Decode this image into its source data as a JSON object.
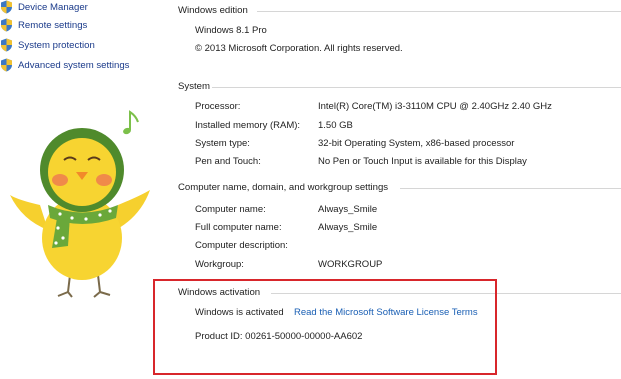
{
  "sidebar": {
    "items": [
      {
        "label": "Device Manager"
      },
      {
        "label": "Remote settings"
      },
      {
        "label": "System protection"
      },
      {
        "label": "Advanced system settings"
      }
    ]
  },
  "windows_edition": {
    "title": "Windows edition",
    "edition": "Windows 8.1 Pro",
    "copyright": "© 2013 Microsoft Corporation. All rights reserved."
  },
  "system": {
    "title": "System",
    "rows": [
      {
        "label": "Processor:",
        "value": "Intel(R) Core(TM) i3-3110M CPU @ 2.40GHz   2.40 GHz"
      },
      {
        "label": "Installed memory (RAM):",
        "value": "1.50 GB"
      },
      {
        "label": "System type:",
        "value": "32-bit Operating System, x86-based processor"
      },
      {
        "label": "Pen and Touch:",
        "value": "No Pen or Touch Input is available for this Display"
      }
    ]
  },
  "computer_name": {
    "title": "Computer name, domain, and workgroup settings",
    "rows": [
      {
        "label": "Computer name:",
        "value": "Always_Smile"
      },
      {
        "label": "Full computer name:",
        "value": "Always_Smile"
      },
      {
        "label": "Computer description:",
        "value": ""
      },
      {
        "label": "Workgroup:",
        "value": "WORKGROUP"
      }
    ]
  },
  "activation": {
    "title": "Windows activation",
    "status": "Windows is activated",
    "license_link": "Read the Microsoft Software License Terms",
    "product_id": "Product ID:  00261-50000-00000-AA602"
  },
  "colors": {
    "link": "#1a5fb4",
    "highlight": "#d8262b"
  }
}
